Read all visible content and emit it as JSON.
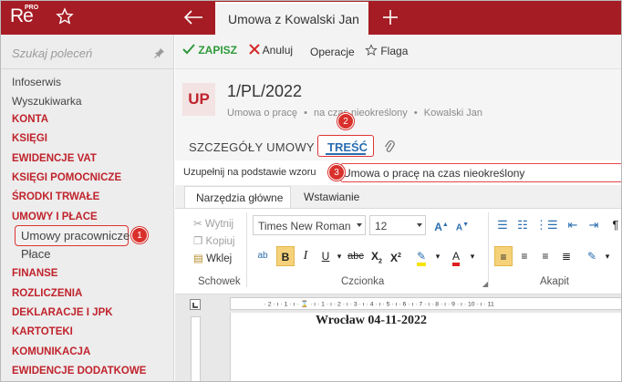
{
  "app": {
    "logo_main": "Re",
    "logo_badge": "PRO"
  },
  "topbar": {
    "active_tab": "Umowa z Kowalski Jan"
  },
  "sidebar": {
    "search_placeholder": "Szukaj poleceń",
    "items": [
      {
        "label": "Infoserwis",
        "kind": "plain"
      },
      {
        "label": "Wyszukiwarka",
        "kind": "plain"
      },
      {
        "label": "KONTA",
        "kind": "category"
      },
      {
        "label": "KSIĘGI",
        "kind": "category"
      },
      {
        "label": "EWIDENCJE VAT",
        "kind": "category"
      },
      {
        "label": "KSIĘGI POMOCNICZE",
        "kind": "category"
      },
      {
        "label": "ŚRODKI TRWAŁE",
        "kind": "category"
      },
      {
        "label": "UMOWY I PŁACE",
        "kind": "category"
      },
      {
        "label": "Umowy pracownicze",
        "kind": "sub",
        "highlighted": true
      },
      {
        "label": "Płace",
        "kind": "sub"
      },
      {
        "label": "FINANSE",
        "kind": "category"
      },
      {
        "label": "ROZLICZENIA",
        "kind": "category"
      },
      {
        "label": "DEKLARACJE I JPK",
        "kind": "category"
      },
      {
        "label": "KARTOTEKI",
        "kind": "category"
      },
      {
        "label": "KOMUNIKACJA",
        "kind": "category"
      },
      {
        "label": "EWIDENCJE DODATKOWE",
        "kind": "category"
      }
    ]
  },
  "toolbar": {
    "save": "ZAPISZ",
    "cancel": "Anuluj",
    "operations": "Operacje",
    "flag": "Flaga"
  },
  "document": {
    "badge": "UP",
    "number": "1/PL/2022",
    "type": "Umowa o pracę",
    "term": "na czas nieokreślony",
    "person": "Kowalski Jan"
  },
  "tabs": {
    "details": "SZCZEGÓŁY UMOWY",
    "content": "TREŚĆ"
  },
  "fill": {
    "label": "Uzupełnij na podstawie wzoru",
    "value": "Umowa o pracę na czas nieokreślony"
  },
  "ribbon": {
    "tabs": [
      "Narzędzia główne",
      "Wstawianie"
    ],
    "clipboard": {
      "cut": "Wytnij",
      "copy": "Kopiuj",
      "paste": "Wklej",
      "group": "Schowek"
    },
    "font": {
      "family": "Times New Roman",
      "size": "12",
      "group": "Czcionka"
    },
    "paragraph": {
      "group": "Akapit"
    }
  },
  "page": {
    "text": "Wrocław 04-11-2022"
  },
  "annotations": [
    "1",
    "2",
    "3"
  ],
  "colors": {
    "brand": "#a51c24",
    "accent_red": "#c0232c",
    "link_blue": "#2a6db0",
    "save_green": "#2e9a3b"
  }
}
